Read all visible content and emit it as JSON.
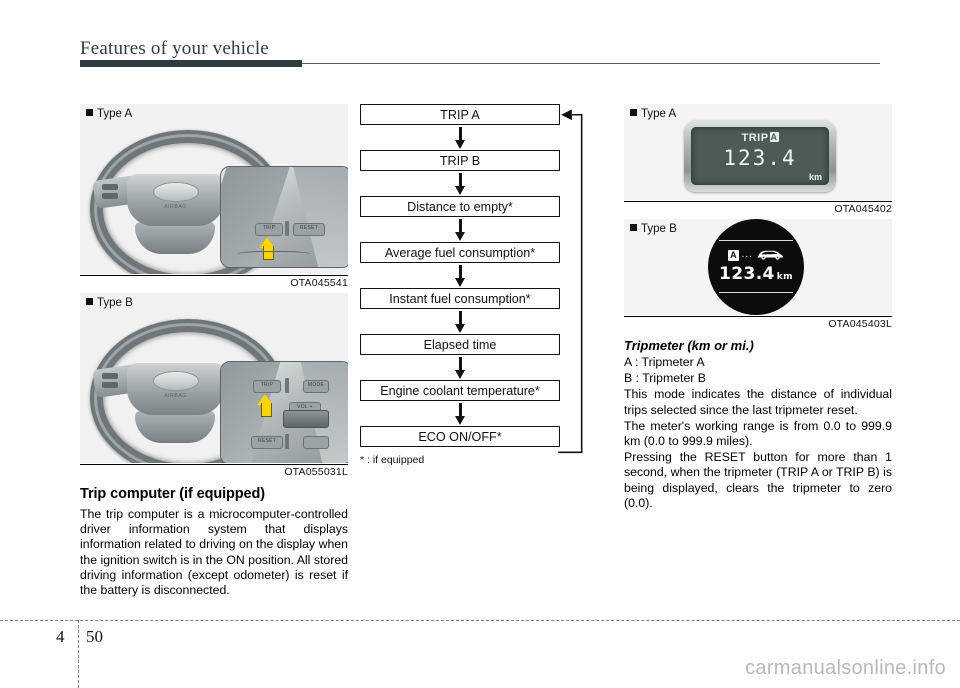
{
  "header": {
    "title": "Features of your vehicle"
  },
  "footer": {
    "chapter": "4",
    "page": "50",
    "watermark": "carmanualsonline.info"
  },
  "left_column": {
    "figures": [
      {
        "label": "Type A",
        "label_marker": "square-bullet",
        "caption": "OTA045541",
        "button_labels": {
          "trip": "TRIP",
          "reset": "RESET"
        },
        "hub_text": "AIRBAG",
        "arrow_icon": "yellow-up-arrow-icon"
      },
      {
        "label": "Type B",
        "label_marker": "square-bullet",
        "caption": "OTA055031L",
        "button_labels": {
          "trip": "TRIP",
          "reset": "RESET",
          "vol": "VOL +",
          "mode": "MODE"
        },
        "hub_text": "AIRBAG",
        "arrow_icon": "yellow-up-arrow-icon"
      }
    ],
    "section_title": "Trip computer (if equipped)",
    "paragraphs": [
      "The trip computer is a microcomputer-controlled driver information system that displays information related to driving on the display when the ignition switch is in the ON position. All stored driving information (except odometer) is reset if the battery is disconnected."
    ]
  },
  "middle_column": {
    "flow": {
      "steps": [
        "TRIP A",
        "TRIP B",
        "Distance to empty*",
        "Average fuel consumption*",
        "Instant fuel consumption*",
        "Elapsed time",
        "Engine coolant temperature*",
        "ECO ON/OFF*"
      ],
      "loop_from": "ECO ON/OFF*",
      "loop_to": "TRIP A",
      "footnote": "* : if equipped"
    }
  },
  "right_column": {
    "figures": [
      {
        "label": "Type A",
        "label_marker": "square-bullet",
        "caption": "OTA045402",
        "display": {
          "mode_text": "TRIP",
          "mode_badge": "A",
          "value": "123.4",
          "unit": "km"
        }
      },
      {
        "label": "Type B",
        "label_marker": "square-bullet",
        "caption": "OTA045403L",
        "display": {
          "mode_badge": "A",
          "dots": "...",
          "vehicle_icon": "car-side-icon",
          "value": "123.4",
          "unit": "km"
        }
      }
    ],
    "sub_title": "Tripmeter (km or mi.)",
    "definitions": [
      "A : Tripmeter A",
      "B : Tripmeter B"
    ],
    "paragraphs": [
      "This mode indicates the distance of individual trips selected since the last tripmeter reset.",
      "The meter's working range is from 0.0 to 999.9 km (0.0 to 999.9 miles).",
      "Pressing the RESET button for more than 1 second, when the tripmeter (TRIP A or TRIP B) is being displayed, clears the tripmeter to zero (0.0)."
    ]
  },
  "colors": {
    "header_rule": "#2f3b40",
    "arrow_highlight": "#ffd400",
    "lcd_background": "#4c5a58",
    "round_display_background": "#0c0c0c",
    "watermark": "#b8b8b8"
  }
}
